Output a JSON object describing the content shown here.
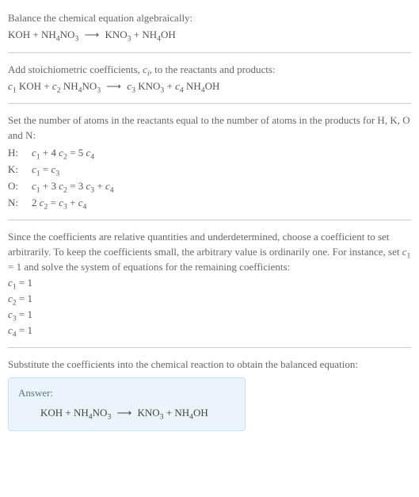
{
  "section1": {
    "intro": "Balance the chemical equation algebraically:"
  },
  "reaction_base": {
    "lhs1": "KOH",
    "plus": " + ",
    "lhs2_a": "NH",
    "lhs2_b": "4",
    "lhs2_c": "NO",
    "lhs2_d": "3",
    "arrow": "⟶",
    "rhs1_a": "KNO",
    "rhs1_b": "3",
    "rhs2_a": "NH",
    "rhs2_b": "4",
    "rhs2_c": "OH"
  },
  "section2": {
    "intro_a": "Add stoichiometric coefficients, ",
    "intro_ci": "c",
    "intro_ci_sub": "i",
    "intro_b": ", to the reactants and products:"
  },
  "coef_reaction": {
    "c1": "c",
    "c1s": "1",
    "sp": " ",
    "c2": "c",
    "c2s": "2",
    "c3": "c",
    "c3s": "3",
    "c4": "c",
    "c4s": "4"
  },
  "section3": {
    "intro": "Set the number of atoms in the reactants equal to the number of atoms in the products for H, K, O and N:",
    "rows": [
      {
        "el": "H:",
        "lhs_c1": "c",
        "lhs_c1s": "1",
        "mid": " + 4 ",
        "lhs_c2": "c",
        "lhs_c2s": "2",
        "eq": " = 5 ",
        "rhs_c": "c",
        "rhs_cs": "4"
      },
      {
        "el": "K:",
        "lhs_c1": "c",
        "lhs_c1s": "1",
        "eq": " = ",
        "rhs_c": "c",
        "rhs_cs": "3"
      },
      {
        "el": "O:",
        "lhs_c1": "c",
        "lhs_c1s": "1",
        "mid": " + 3 ",
        "lhs_c2": "c",
        "lhs_c2s": "2",
        "eq": " = 3 ",
        "rhs_c": "c",
        "rhs_cs": "3",
        "tail_plus": " + ",
        "tail_c": "c",
        "tail_cs": "4"
      },
      {
        "el": "N:",
        "pre": "2 ",
        "lhs_c1": "c",
        "lhs_c1s": "2",
        "eq": " = ",
        "rhs_c": "c",
        "rhs_cs": "3",
        "tail_plus": " + ",
        "tail_c": "c",
        "tail_cs": "4"
      }
    ]
  },
  "section4": {
    "intro_a": "Since the coefficients are relative quantities and underdetermined, choose a coefficient to set arbitrarily. To keep the coefficients small, the arbitrary value is ordinarily one. For instance, set ",
    "set_c": "c",
    "set_cs": "1",
    "intro_b": " = 1 and solve the system of equations for the remaining coefficients:",
    "vals": [
      {
        "c": "c",
        "s": "1",
        "v": " = 1"
      },
      {
        "c": "c",
        "s": "2",
        "v": " = 1"
      },
      {
        "c": "c",
        "s": "3",
        "v": " = 1"
      },
      {
        "c": "c",
        "s": "4",
        "v": " = 1"
      }
    ]
  },
  "section5": {
    "intro": "Substitute the coefficients into the chemical reaction to obtain the balanced equation:",
    "answer_label": "Answer:"
  }
}
